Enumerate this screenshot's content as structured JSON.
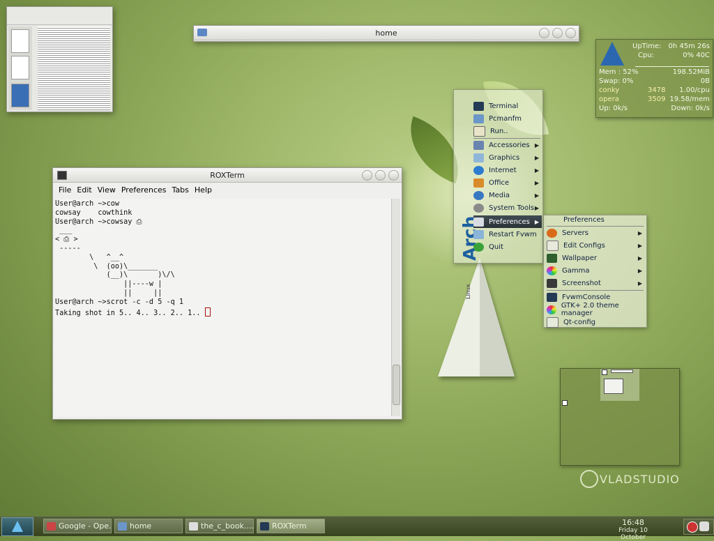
{
  "windows": {
    "home": {
      "title": "home"
    },
    "roxterm": {
      "title": "ROXTerm",
      "menu": [
        "File",
        "Edit",
        "View",
        "Preferences",
        "Tabs",
        "Help"
      ],
      "terminal_lines": [
        "User@arch ~>cow",
        "cowsay    cowthink",
        "User@arch ~>cowsay ⎙",
        " ___",
        "< ⎙ >",
        " -----",
        "        \\   ^__^",
        "         \\  (oo)\\_______",
        "            (__)\\       )\\/\\",
        "                ||----w |",
        "                ||     ||",
        "User@arch ~>scrot -c -d 5 -q 1",
        "Taking shot in 5.. 4.. 3.. 2.. 1.. "
      ]
    }
  },
  "arch_menu": {
    "items": [
      {
        "label": "Terminal",
        "icon": "terminal-icon",
        "submenu": false
      },
      {
        "label": "Pcmanfm",
        "icon": "folder-icon",
        "submenu": false
      },
      {
        "label": "Run..",
        "icon": "run-icon",
        "submenu": false
      },
      {
        "label": "Accessories",
        "icon": "accessories-icon",
        "submenu": true
      },
      {
        "label": "Graphics",
        "icon": "graphics-icon",
        "submenu": true
      },
      {
        "label": "Internet",
        "icon": "internet-icon",
        "submenu": true
      },
      {
        "label": "Office",
        "icon": "office-icon",
        "submenu": true
      },
      {
        "label": "Media",
        "icon": "media-icon",
        "submenu": true
      },
      {
        "label": "System Tools",
        "icon": "system-tools-icon",
        "submenu": true
      },
      {
        "label": "Preferences",
        "icon": "preferences-icon",
        "submenu": true
      },
      {
        "label": "Restart Fvwm",
        "icon": "restart-icon",
        "submenu": false
      },
      {
        "label": "Quit",
        "icon": "quit-icon",
        "submenu": false
      }
    ],
    "side_text": "Arch",
    "side_sub": "Linux"
  },
  "pref_menu": {
    "title": "Preferences",
    "items": [
      {
        "label": "Servers",
        "icon": "servers-icon",
        "submenu": true
      },
      {
        "label": "Edit Configs",
        "icon": "edit-configs-icon",
        "submenu": true
      },
      {
        "label": "Wallpaper",
        "icon": "wallpaper-icon",
        "submenu": true
      },
      {
        "label": "Gamma",
        "icon": "gamma-icon",
        "submenu": true
      },
      {
        "label": "Screenshot",
        "icon": "camera-icon",
        "submenu": true
      },
      {
        "label": "FvwmConsole",
        "icon": "console-icon",
        "submenu": false
      },
      {
        "label": "GTK+ 2.0 theme manager",
        "icon": "gtk-icon",
        "submenu": false
      },
      {
        "label": "Qt-config",
        "icon": "qt-icon",
        "submenu": false
      }
    ]
  },
  "conky": {
    "uptime_label": "UpTime:",
    "uptime_value": "0h 45m 26s",
    "cpu_label": "Cpu:",
    "cpu_value": "0% 40C",
    "mem_label": "Mem : 52%",
    "mem_value": "198.52MiB",
    "swap_label": "Swap: 0%",
    "swap_value": "0B",
    "proc1_name": "conky",
    "proc1_pid": "3478",
    "proc1_val": "1.00/cpu",
    "proc2_name": "opera",
    "proc2_pid": "3509",
    "proc2_val": "19.58/mem",
    "up_label": "Up: 0k/s",
    "down_label": "Down: 0k/s"
  },
  "wallpaper_brand": "VLADSTUDIO",
  "taskbar": {
    "tasks": [
      {
        "label": "Google - Ope...",
        "icon": "opera-icon"
      },
      {
        "label": "home",
        "icon": "folder-icon"
      },
      {
        "label": "the_c_book....",
        "icon": "document-icon"
      },
      {
        "label": "ROXTerm",
        "icon": "terminal-icon"
      }
    ],
    "clock_time": "16:48",
    "clock_date": "Friday 10 October"
  },
  "colors": {
    "accent": "#2b67b0",
    "menu_selected": "#2b3338",
    "terminal_bg": "#f3f3f1"
  }
}
